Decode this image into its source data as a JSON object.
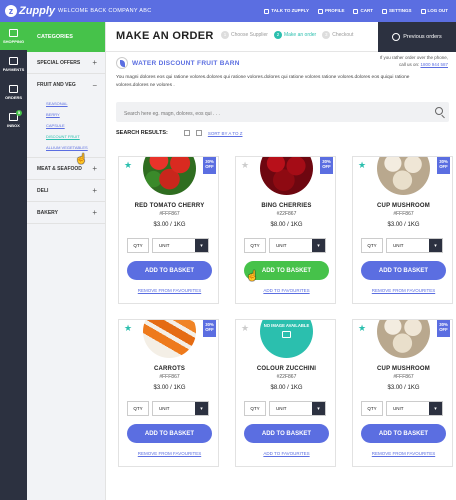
{
  "app": {
    "logo": "Zupply",
    "welcome": "WELCOME BACK COMPANY ABC",
    "nav": [
      {
        "label": "TALK TO ZUPPLY",
        "icon": "chat-icon"
      },
      {
        "label": "PROFILE",
        "icon": "user-icon"
      },
      {
        "label": "CART",
        "icon": "cart-icon"
      },
      {
        "label": "SETTINGS",
        "icon": "gear-icon"
      },
      {
        "label": "LOG OUT",
        "icon": "logout-icon"
      }
    ]
  },
  "rail": [
    {
      "label": "SHOPPING",
      "icon": "shopping-icon"
    },
    {
      "label": "PAYMENTS",
      "icon": "payments-icon"
    },
    {
      "label": "ORDERS",
      "icon": "orders-icon"
    },
    {
      "label": "INBOX",
      "icon": "inbox-icon",
      "badge": "5"
    }
  ],
  "categories": {
    "title": "CATEGORIES",
    "items": [
      {
        "label": "SPECIAL OFFERS",
        "toggle": "+"
      },
      {
        "label": "FRUIT AND VEG",
        "toggle": "−",
        "subs": [
          "SEASONAL",
          "BERRY",
          "CAPSULE",
          "DISCOUNT FRUIT",
          "ALLIUM VEGETABLES"
        ]
      },
      {
        "label": "MEAT & SEAFOOD",
        "toggle": "+"
      },
      {
        "label": "DELI",
        "toggle": "+"
      },
      {
        "label": "BAKERY",
        "toggle": "+"
      }
    ]
  },
  "page": {
    "title": "MAKE AN ORDER",
    "steps": [
      {
        "num": "1",
        "label": "Choose Supplier"
      },
      {
        "num": "2",
        "label": "Make an order"
      },
      {
        "num": "3",
        "label": "Checkout"
      }
    ],
    "prev_orders": "Previous orders",
    "supplier": "WATER DISCOUNT FRUIT BARN",
    "phone_text": "If you rather order over the phone,",
    "phone_call": "call us on:",
    "phone_num": "1800 944 587",
    "desc": "You magni dolores eos qui ratione volores.dolores qui ratione volores.dolores qui ratione volores ratione volores.dolores eos quiqui ratione volores.dolores ne volores .",
    "search_placeholder": "Search here eg. magn, dolores, eos qui . . .",
    "results_label": "SEARCH RESULTS:",
    "sort": "SORT BY A TO Z"
  },
  "products": [
    {
      "name": "RED TOMATO CHERRY",
      "code": "#FFF867",
      "price": "$3.00 / 1KG",
      "ribbon": "30% OFF",
      "fav": true,
      "img": "tomato",
      "button": "ADD TO BASKET",
      "link": "REMOVE FROM FAVOURITES",
      "qty": "QTY",
      "unit": "UNIT"
    },
    {
      "name": "BING CHERRIES",
      "code": "#22F867",
      "price": "$8.00 / 1KG",
      "ribbon": "30% OFF",
      "fav": false,
      "img": "cherry",
      "button": "ADD TO BASKET",
      "link": "ADD TO FAVOURITES",
      "qty": "QTY",
      "unit": "UNIT"
    },
    {
      "name": "CUP MUSHROOM",
      "code": "#FFF867",
      "price": "$3.00 / 1KG",
      "ribbon": "30% OFF",
      "fav": true,
      "img": "mushroom",
      "button": "ADD TO BASKET",
      "link": "REMOVE FROM FAVOURITES",
      "qty": "QTY",
      "unit": "UNIT"
    },
    {
      "name": "CARROTS",
      "code": "#FFF867",
      "price": "$3.00 / 1KG",
      "ribbon": "30% OFF",
      "fav": true,
      "img": "carrot",
      "button": "ADD TO BASKET",
      "link": "REMOVE FROM FAVOURITES",
      "qty": "QTY",
      "unit": "UNIT"
    },
    {
      "name": "COLOUR ZUCCHINI",
      "code": "#22F867",
      "price": "$8.00 / 1KG",
      "ribbon": "",
      "fav": false,
      "img": "none",
      "noimg_text": "NO IMAGE AVAILABLE",
      "button": "ADD TO BASKET",
      "link": "ADD TO FAVOURITES",
      "qty": "QTY",
      "unit": "UNIT"
    },
    {
      "name": "CUP MUSHROOM",
      "code": "#FFF867",
      "price": "$3.00 / 1KG",
      "ribbon": "30% OFF",
      "fav": true,
      "img": "mushroom",
      "button": "ADD TO BASKET",
      "link": "REMOVE FROM FAVOURITES",
      "qty": "QTY",
      "unit": "UNIT"
    }
  ],
  "colors": {
    "brand": "#5b6ee1",
    "green": "#46c24a",
    "teal": "#2bbfae",
    "dark": "#2c3140"
  }
}
